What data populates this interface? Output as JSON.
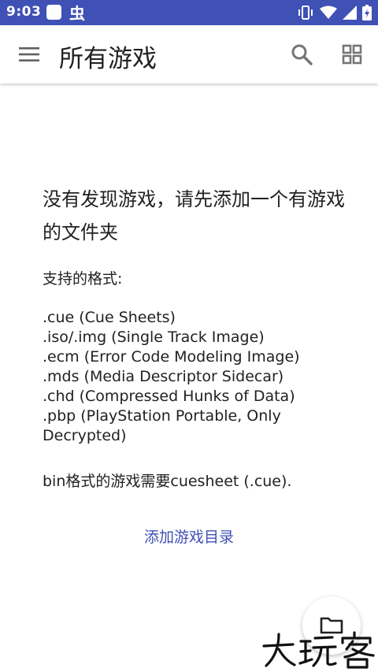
{
  "status_bar": {
    "time": "9:03",
    "icons": [
      "notification-square-icon",
      "bug-icon",
      "vibrate-icon",
      "wifi-icon",
      "signal-icon",
      "battery-icon"
    ]
  },
  "app_bar": {
    "title": "所有游戏",
    "icons": [
      "menu-icon",
      "search-icon",
      "grid-view-icon"
    ]
  },
  "empty_state": {
    "title": "没有发现游戏，请先添加一个有游戏的文件夹",
    "formats_heading": "支持的格式:",
    "formats": [
      ".cue (Cue Sheets)",
      ".iso/.img (Single Track Image)",
      ".ecm (Error Code Modeling Image)",
      ".mds (Media Descriptor Sidecar)",
      ".chd (Compressed Hunks of Data)",
      ".pbp (PlayStation Portable, Only Decrypted)"
    ],
    "bin_note": "bin格式的游戏需要cuesheet (.cue).",
    "add_directory_label": "添加游戏目录"
  },
  "fab": {
    "icon": "folder-icon"
  },
  "colors": {
    "status_bar": "#3f51b5",
    "accent": "#3f51b5",
    "text_primary": "#212121",
    "icon_gray": "#757575"
  }
}
